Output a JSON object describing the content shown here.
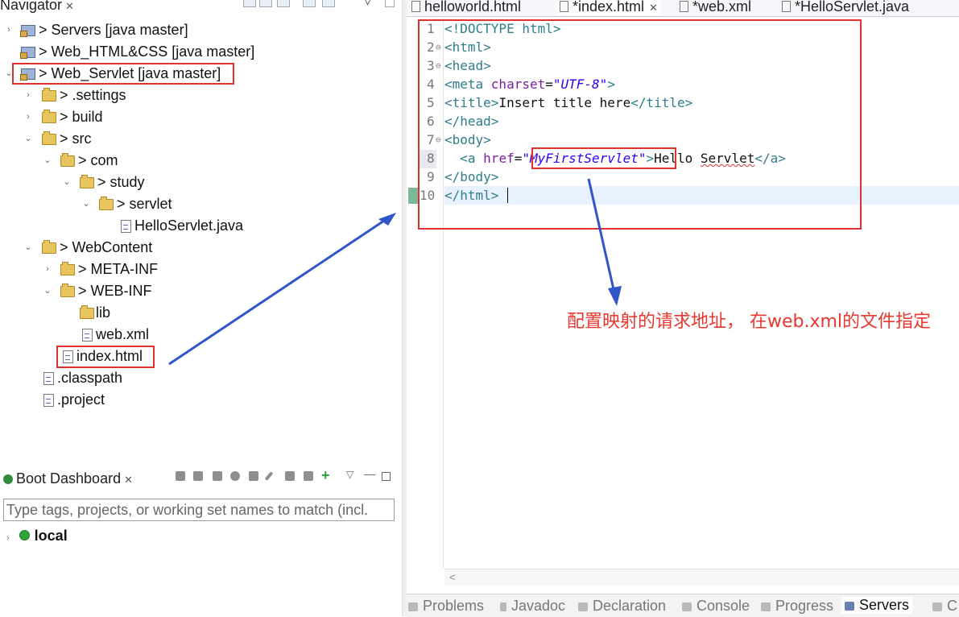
{
  "navigator": {
    "title": "Navigator",
    "close": "✕",
    "items": [
      {
        "label": "> Servers [java master]"
      },
      {
        "label": "> Web_HTML&CSS [java master]"
      },
      {
        "label": "> Web_Servlet [java master]"
      },
      {
        "label": "> .settings"
      },
      {
        "label": "> build"
      },
      {
        "label": "> src"
      },
      {
        "label": "> com"
      },
      {
        "label": "> study"
      },
      {
        "label": "> servlet"
      },
      {
        "label": "HelloServlet.java"
      },
      {
        "label": "> WebContent"
      },
      {
        "label": "> META-INF"
      },
      {
        "label": "> WEB-INF"
      },
      {
        "label": "lib"
      },
      {
        "label": "web.xml"
      },
      {
        "label": "index.html"
      },
      {
        "label": ".classpath"
      },
      {
        "label": ".project"
      }
    ]
  },
  "boot_dashboard": {
    "title": "Boot Dashboard",
    "close": "✕",
    "filter_placeholder": "Type tags, projects, or working set names to match (incl.",
    "local_label": "local"
  },
  "editor": {
    "tabs": [
      {
        "label": "helloworld.html"
      },
      {
        "label": "*index.html",
        "close": "✕"
      },
      {
        "label": "*web.xml"
      },
      {
        "label": "*HelloServlet.java"
      }
    ],
    "line_numbers": [
      "1",
      "2",
      "3",
      "4",
      "5",
      "6",
      "7",
      "8",
      "9",
      "10"
    ],
    "code": {
      "l1": "<!DOCTYPE html>",
      "l2": "<html>",
      "l3": "<head>",
      "l4_open": "<meta ",
      "l4_attr": "charset",
      "l4_eq": "=",
      "l4_val": "\"UTF-8\"",
      "l4_close": ">",
      "l5_open": "<title>",
      "l5_text": "Insert title here",
      "l5_close": "</title>",
      "l6": "</head>",
      "l7": "<body>",
      "l8_indent": "  ",
      "l8_open": "<a ",
      "l8_attr": "href",
      "l8_eq": "=",
      "l8_val": "\"MyFirstServlet\"",
      "l8_gt": ">",
      "l8_text1": "Hello ",
      "l8_text2": "Servlet",
      "l8_close": "</a>",
      "l9": "</body>",
      "l10": "</html>"
    }
  },
  "bottom_tabs": [
    {
      "label": "Problems"
    },
    {
      "label": "Javadoc"
    },
    {
      "label": "Declaration"
    },
    {
      "label": "Console"
    },
    {
      "label": "Progress"
    },
    {
      "label": "Servers"
    },
    {
      "label": "C"
    }
  ],
  "annotation": {
    "text": "配置映射的请求地址， 在web.xml的文件指定"
  },
  "colors": {
    "highlight_red": "#e0312e",
    "arrow_blue": "#2f55c9",
    "tag_teal": "#2e7d8c",
    "attr_purple": "#7a1fa2",
    "value_blue": "#2a00ff"
  }
}
